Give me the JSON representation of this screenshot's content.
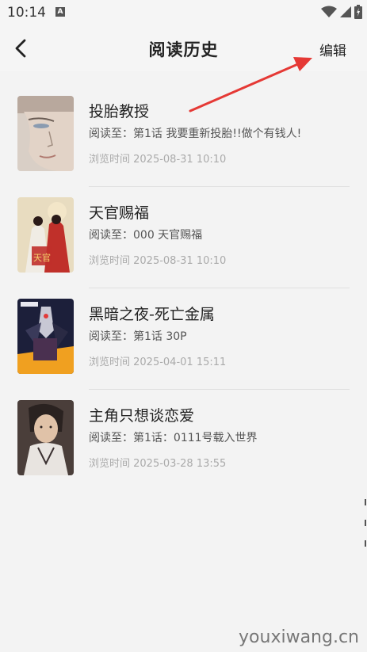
{
  "status_bar": {
    "time": "10:14",
    "notification_icon": "A"
  },
  "app_bar": {
    "title": "阅读历史",
    "edit_label": "编辑",
    "back_icon": "chevron-left-icon"
  },
  "history": [
    {
      "title": "投胎教授",
      "progress": "阅读至：第1话 我要重新投胎!!做个有钱人!",
      "time": "浏览时间 2025-08-31 10:10"
    },
    {
      "title": "天官赐福",
      "progress": "阅读至：000 天官赐福",
      "time": "浏览时间 2025-08-31 10:10"
    },
    {
      "title": "黑暗之夜-死亡金属",
      "progress": "阅读至：第1话 30P",
      "time": "浏览时间 2025-04-01 15:11"
    },
    {
      "title": "主角只想谈恋爱",
      "progress": "阅读至：第1话：0111号载入世界",
      "time": "浏览时间 2025-03-28 13:55"
    }
  ],
  "watermark": "youxiwang.cn",
  "colors": {
    "background": "#f3f3f3",
    "annotation_arrow": "#e53935"
  }
}
